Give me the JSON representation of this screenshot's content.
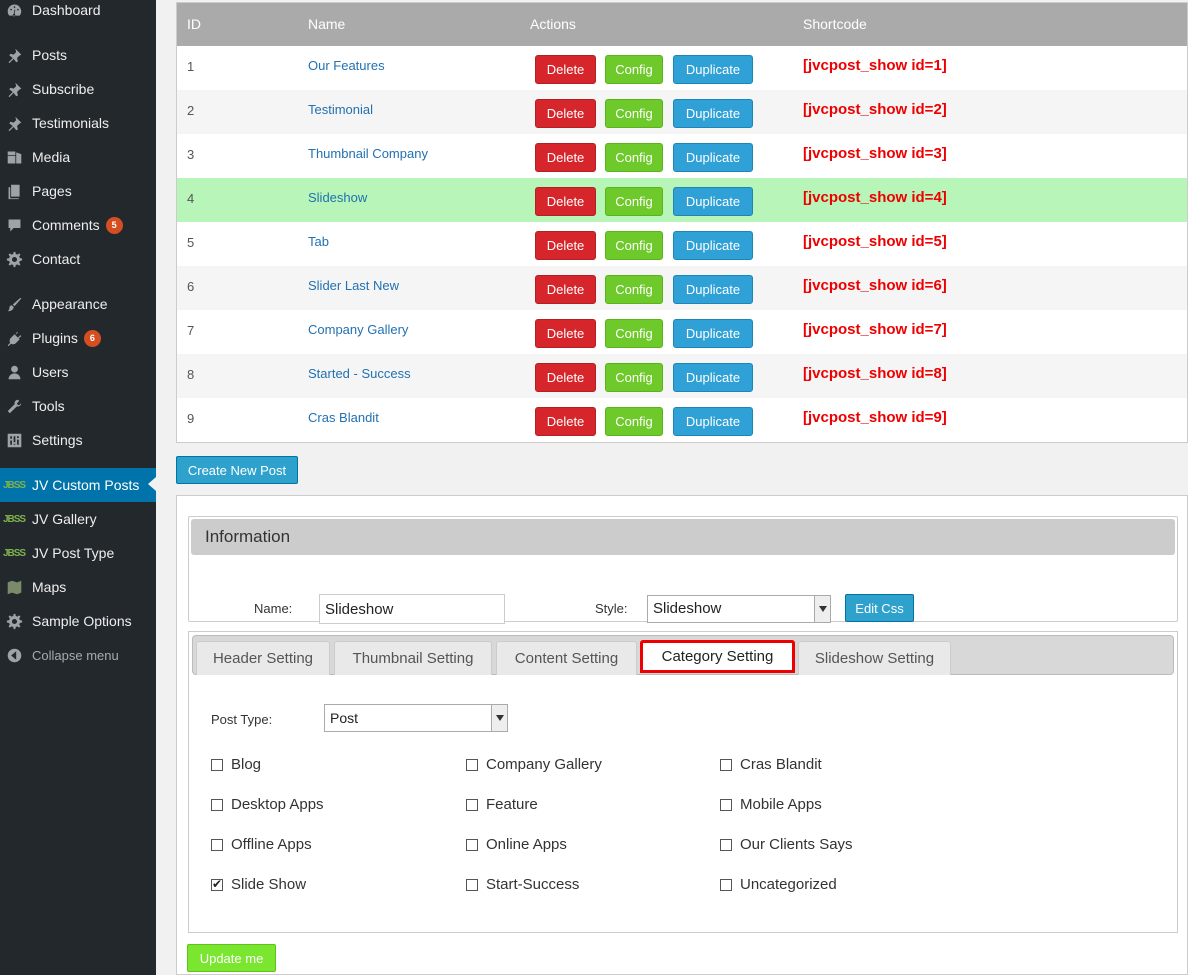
{
  "sidebar": {
    "items": [
      {
        "label": "Dashboard",
        "icon": "dashboard-icon",
        "badge": ""
      },
      {
        "label": "Posts",
        "icon": "pin-icon",
        "badge": ""
      },
      {
        "label": "Subscribe",
        "icon": "pin-icon",
        "badge": ""
      },
      {
        "label": "Testimonials",
        "icon": "pin-icon",
        "badge": ""
      },
      {
        "label": "Media",
        "icon": "media-icon",
        "badge": ""
      },
      {
        "label": "Pages",
        "icon": "pages-icon",
        "badge": ""
      },
      {
        "label": "Comments",
        "icon": "comment-icon",
        "badge": "5"
      },
      {
        "label": "Contact",
        "icon": "gear-icon",
        "badge": ""
      },
      {
        "label": "Appearance",
        "icon": "brush-icon",
        "badge": ""
      },
      {
        "label": "Plugins",
        "icon": "plug-icon",
        "badge": "6"
      },
      {
        "label": "Users",
        "icon": "user-icon",
        "badge": ""
      },
      {
        "label": "Tools",
        "icon": "wrench-icon",
        "badge": ""
      },
      {
        "label": "Settings",
        "icon": "settings-icon",
        "badge": ""
      },
      {
        "label": "JV Custom Posts",
        "icon": "jv-logo-icon",
        "badge": ""
      },
      {
        "label": "JV Gallery",
        "icon": "jv-logo-icon",
        "badge": ""
      },
      {
        "label": "JV Post Type",
        "icon": "jv-logo-icon",
        "badge": ""
      },
      {
        "label": "Maps",
        "icon": "map-icon",
        "badge": ""
      },
      {
        "label": "Sample Options",
        "icon": "gear-icon",
        "badge": ""
      },
      {
        "label": "Collapse menu",
        "icon": "collapse-icon",
        "badge": ""
      }
    ],
    "jv_logo_text": "JBSS"
  },
  "table": {
    "headers": {
      "id": "ID",
      "name": "Name",
      "actions": "Actions",
      "shortcode": "Shortcode"
    },
    "rows": [
      {
        "id": "1",
        "name": "Our Features",
        "shortcode": "[jvcpost_show id=1]"
      },
      {
        "id": "2",
        "name": "Testimonial",
        "shortcode": "[jvcpost_show id=2]"
      },
      {
        "id": "3",
        "name": "Thumbnail Company",
        "shortcode": "[jvcpost_show id=3]"
      },
      {
        "id": "4",
        "name": "Slideshow",
        "shortcode": "[jvcpost_show id=4]"
      },
      {
        "id": "5",
        "name": "Tab",
        "shortcode": "[jvcpost_show id=5]"
      },
      {
        "id": "6",
        "name": "Slider Last New",
        "shortcode": "[jvcpost_show id=6]"
      },
      {
        "id": "7",
        "name": "Company Gallery",
        "shortcode": "[jvcpost_show id=7]"
      },
      {
        "id": "8",
        "name": "Started - Success",
        "shortcode": "[jvcpost_show id=8]"
      },
      {
        "id": "9",
        "name": "Cras Blandit",
        "shortcode": "[jvcpost_show id=9]"
      }
    ],
    "delete_label": "Delete",
    "config_label": "Config",
    "duplicate_label": "Duplicate"
  },
  "create_label": "Create New Post",
  "info": {
    "title": "Information",
    "name_label": "Name:",
    "name_value": "Slideshow",
    "style_label": "Style:",
    "style_value": "Slideshow",
    "edit_css_label": "Edit Css"
  },
  "tabs": [
    {
      "label": "Header Setting"
    },
    {
      "label": "Thumbnail Setting"
    },
    {
      "label": "Content Setting"
    },
    {
      "label": "Category Setting"
    },
    {
      "label": "Slideshow Setting"
    }
  ],
  "category": {
    "post_type_label": "Post Type:",
    "post_type_value": "Post",
    "checkboxes": [
      {
        "label": "Blog",
        "checked": false
      },
      {
        "label": "Company Gallery",
        "checked": false
      },
      {
        "label": "Cras Blandit",
        "checked": false
      },
      {
        "label": "Desktop Apps",
        "checked": false
      },
      {
        "label": "Feature",
        "checked": false
      },
      {
        "label": "Mobile Apps",
        "checked": false
      },
      {
        "label": "Offline Apps",
        "checked": false
      },
      {
        "label": "Online Apps",
        "checked": false
      },
      {
        "label": "Our Clients Says",
        "checked": false
      },
      {
        "label": "Slide Show",
        "checked": true
      },
      {
        "label": "Start-Success",
        "checked": false
      },
      {
        "label": "Uncategorized",
        "checked": false
      }
    ]
  },
  "update_label": "Update me",
  "colors": {
    "sidebar_bg": "#23282d",
    "active_menu": "#0073aa",
    "highlight_row": "#b8f5b8",
    "delete": "#d6262b",
    "config": "#6ec92a",
    "duplicate": "#2fa1d6",
    "shortcode": "#ee0000",
    "update": "#7be62f"
  }
}
